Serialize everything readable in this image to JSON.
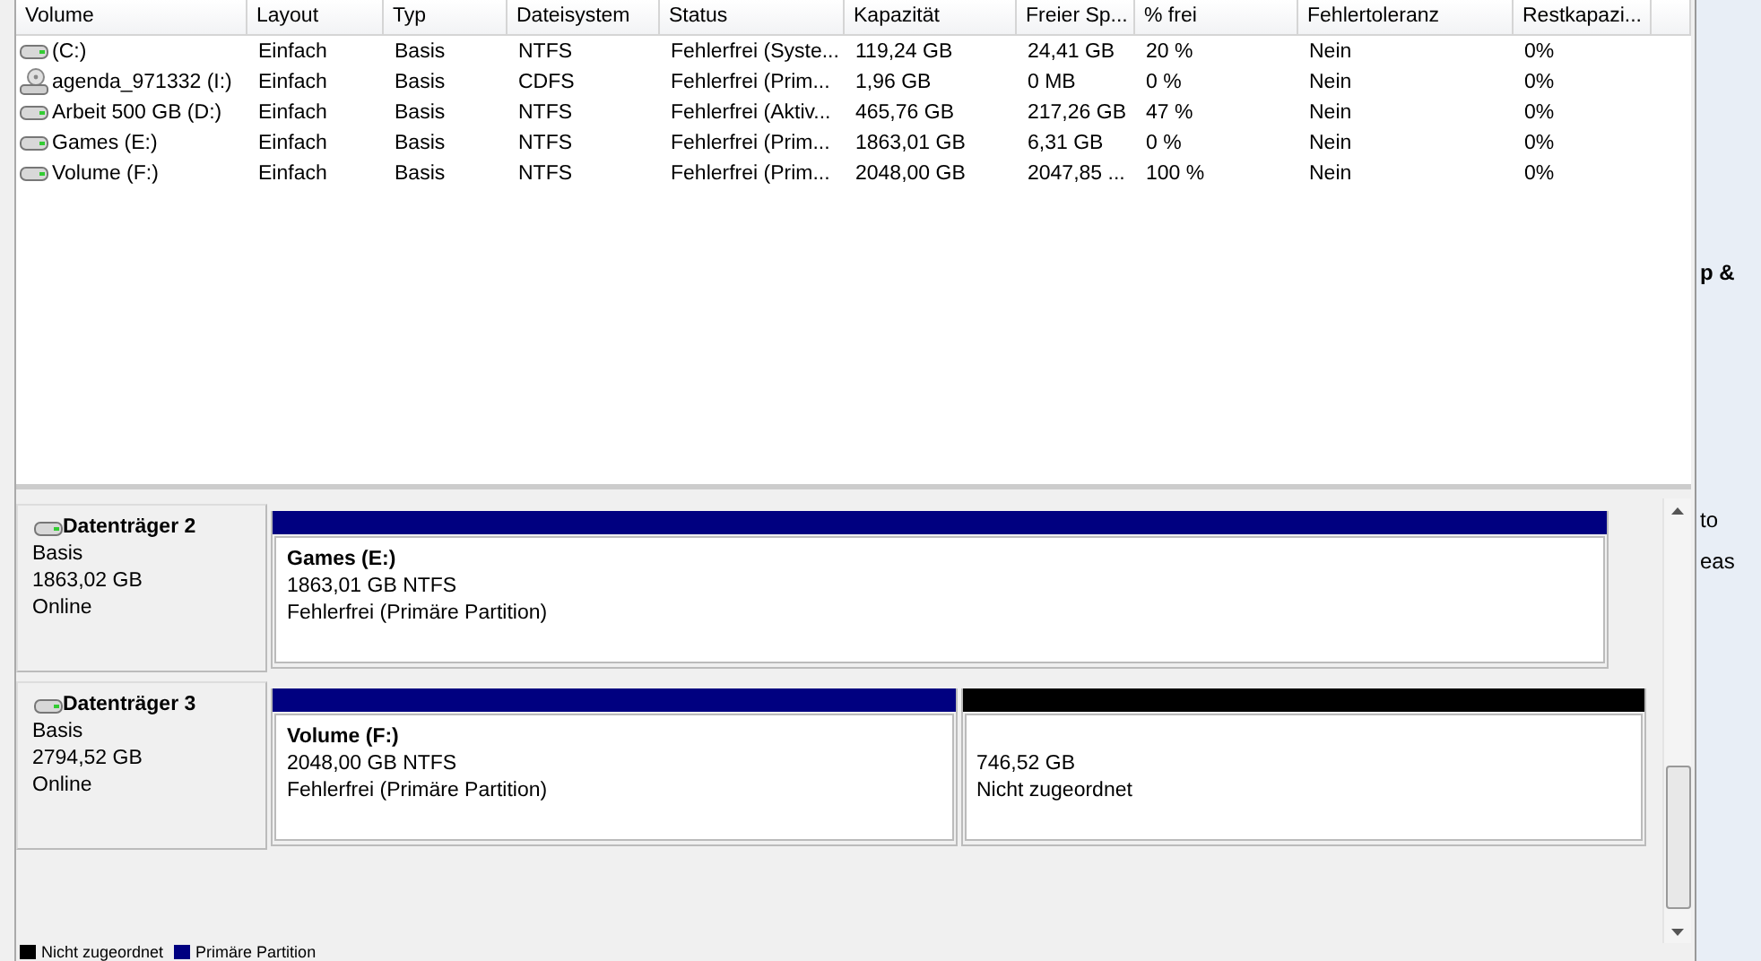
{
  "table": {
    "columns": [
      "Volume",
      "Layout",
      "Typ",
      "Dateisystem",
      "Status",
      "Kapazität",
      "Freier Sp...",
      "% frei",
      "Fehlertoleranz",
      "Restkapazi..."
    ],
    "rows": [
      {
        "kind": "disk",
        "cells": [
          " (C:)",
          "Einfach",
          "Basis",
          "NTFS",
          "Fehlerfrei (Syste...",
          "119,24 GB",
          "24,41 GB",
          "20 %",
          "Nein",
          "0%"
        ]
      },
      {
        "kind": "cd",
        "cells": [
          "agenda_971332 (I:)",
          "Einfach",
          "Basis",
          "CDFS",
          "Fehlerfrei (Prim...",
          "1,96 GB",
          "0 MB",
          "0 %",
          "Nein",
          "0%"
        ]
      },
      {
        "kind": "disk",
        "cells": [
          "Arbeit 500 GB (D:)",
          "Einfach",
          "Basis",
          "NTFS",
          "Fehlerfrei (Aktiv...",
          "465,76 GB",
          "217,26 GB",
          "47 %",
          "Nein",
          "0%"
        ]
      },
      {
        "kind": "disk",
        "cells": [
          "Games (E:)",
          "Einfach",
          "Basis",
          "NTFS",
          "Fehlerfrei (Prim...",
          "1863,01 GB",
          "6,31 GB",
          "0 %",
          "Nein",
          "0%"
        ]
      },
      {
        "kind": "disk",
        "cells": [
          "Volume (F:)",
          "Einfach",
          "Basis",
          "NTFS",
          "Fehlerfrei (Prim...",
          "2048,00 GB",
          "2047,85 ...",
          "100 %",
          "Nein",
          "0%"
        ]
      }
    ]
  },
  "disks": [
    {
      "name": "Datenträger 2",
      "type": "Basis",
      "size": "1863,02 GB",
      "status": "Online",
      "partitions": [
        {
          "color": "#000080",
          "name": "Games  (E:)",
          "size": "1863,01 GB NTFS",
          "status": "Fehlerfrei (Primäre Partition)"
        }
      ]
    },
    {
      "name": "Datenträger 3",
      "type": "Basis",
      "size": "2794,52 GB",
      "status": "Online",
      "partitions": [
        {
          "color": "#000080",
          "name": "Volume  (F:)",
          "size": "2048,00 GB NTFS",
          "status": "Fehlerfrei (Primäre Partition)"
        },
        {
          "color": "#000000",
          "size": "746,52 GB",
          "status": "Nicht zugeordnet"
        }
      ]
    }
  ],
  "legend": [
    {
      "color": "#000000",
      "label": "Nicht zugeordnet"
    },
    {
      "color": "#000080",
      "label": "Primäre Partition"
    }
  ],
  "background_window": {
    "texts": [
      "p &",
      "to",
      "eas"
    ]
  }
}
